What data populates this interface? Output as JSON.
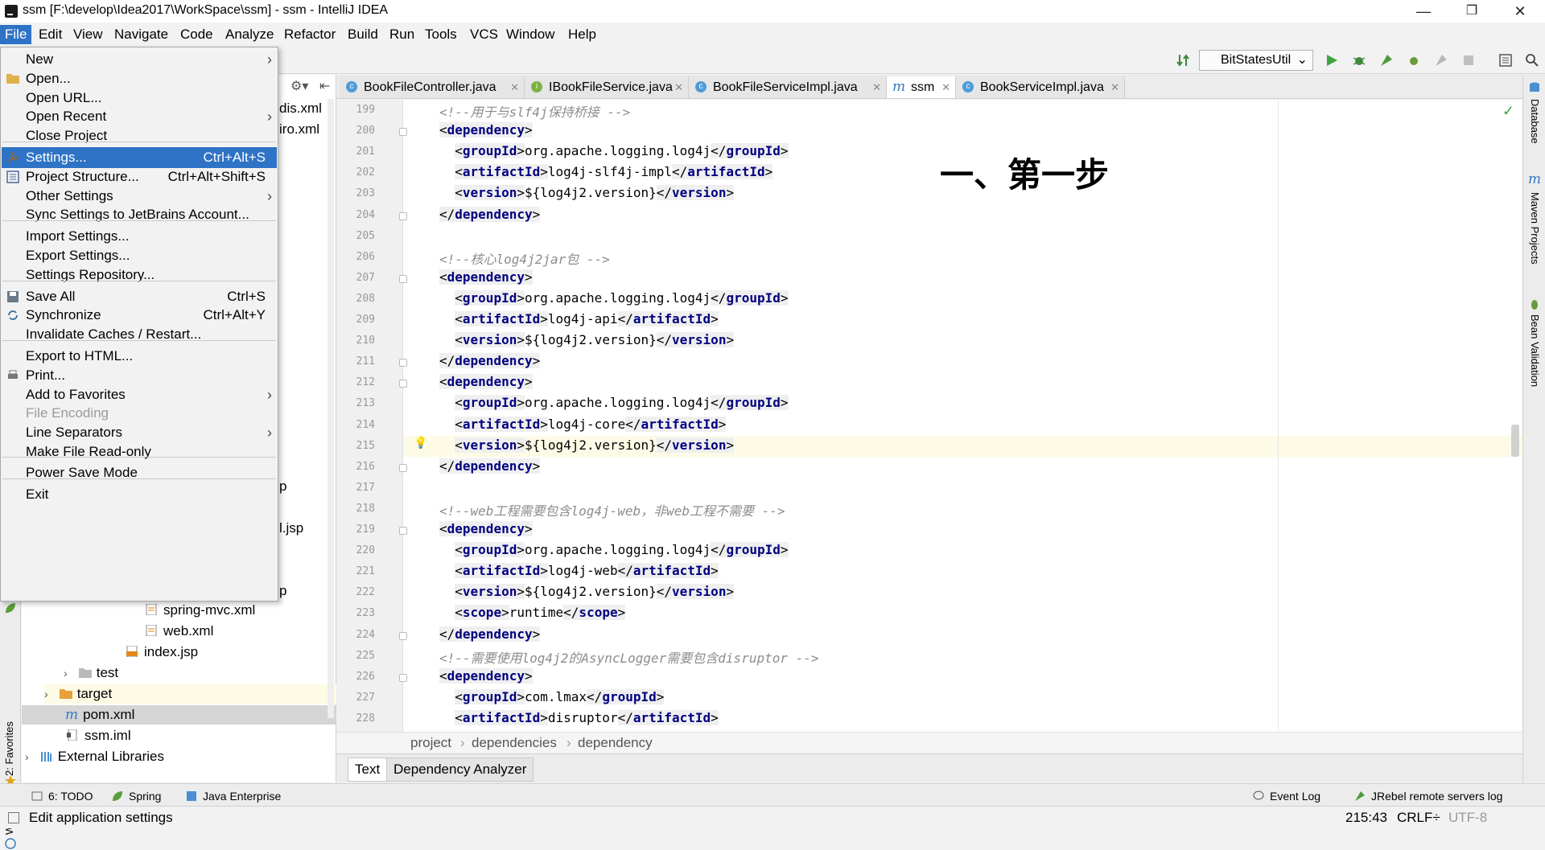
{
  "window": {
    "title": "ssm [F:\\develop\\Idea2017\\WorkSpace\\ssm] - ssm - IntelliJ IDEA",
    "minimize": "—",
    "maximize": "❐",
    "close": "✕"
  },
  "menubar": [
    "File",
    "Edit",
    "View",
    "Navigate",
    "Code",
    "Analyze",
    "Refactor",
    "Build",
    "Run",
    "Tools",
    "VCS",
    "Window",
    "Help"
  ],
  "toolbar": {
    "run_config": "BitStatesUtil"
  },
  "tabs": [
    {
      "label": "BookFileController.java",
      "icon": "class-icon"
    },
    {
      "label": "IBookFileService.java",
      "icon": "interface-icon"
    },
    {
      "label": "BookFileServiceImpl.java",
      "icon": "class-icon"
    },
    {
      "label": "ssm",
      "icon": "maven-icon"
    },
    {
      "label": "BookServiceImpl.java",
      "icon": "class-icon"
    }
  ],
  "file_menu": {
    "items": [
      {
        "label": "New",
        "submenu": true
      },
      {
        "label": "Open...",
        "icon": "folder-icon"
      },
      {
        "label": "Open URL..."
      },
      {
        "label": "Open Recent",
        "submenu": true
      },
      {
        "label": "Close Project"
      },
      {
        "label": "Settings...",
        "shortcut": "Ctrl+Alt+S",
        "icon": "wrench-icon"
      },
      {
        "label": "Project Structure...",
        "shortcut": "Ctrl+Alt+Shift+S",
        "icon": "project-structure-icon"
      },
      {
        "label": "Other Settings",
        "submenu": true
      },
      {
        "label": "Sync Settings to JetBrains Account..."
      },
      {
        "label": "Import Settings..."
      },
      {
        "label": "Export Settings..."
      },
      {
        "label": "Settings Repository..."
      },
      {
        "label": "Save All",
        "shortcut": "Ctrl+S",
        "icon": "save-icon"
      },
      {
        "label": "Synchronize",
        "shortcut": "Ctrl+Alt+Y",
        "icon": "sync-icon"
      },
      {
        "label": "Invalidate Caches / Restart..."
      },
      {
        "label": "Export to HTML..."
      },
      {
        "label": "Print...",
        "icon": "print-icon"
      },
      {
        "label": "Add to Favorites",
        "submenu": true
      },
      {
        "label": "File Encoding",
        "disabled": true
      },
      {
        "label": "Line Separators",
        "submenu": true
      },
      {
        "label": "Make File Read-only"
      },
      {
        "label": "Power Save Mode"
      },
      {
        "label": "Exit"
      }
    ]
  },
  "project_tree": {
    "partial_right": [
      "dis.xml",
      "iro.xml",
      "p",
      "l.jsp",
      "p"
    ],
    "rows": [
      {
        "label": "spring-mvc.xml",
        "icon": "xml-icon"
      },
      {
        "label": "web.xml",
        "icon": "xml-icon"
      },
      {
        "label": "index.jsp",
        "icon": "jsp-icon"
      },
      {
        "label": "test",
        "icon": "folder-icon"
      },
      {
        "label": "target",
        "icon": "folder-orange-icon"
      },
      {
        "label": "pom.xml",
        "icon": "maven-icon"
      },
      {
        "label": "ssm.iml",
        "icon": "iml-icon"
      },
      {
        "label": "External Libraries",
        "icon": "libraries-icon"
      }
    ]
  },
  "left_stripe": {
    "favorites": "2: Favorites",
    "web": "Web"
  },
  "right_stripe": {
    "database": "Database",
    "maven": "Maven Projects",
    "bean": "Bean Validation"
  },
  "editor": {
    "annotation": "一、第一步",
    "lines": [
      {
        "n": "199",
        "text": "<!--用于与slf4j保持桥接 -->"
      },
      {
        "n": "200",
        "text": "<dependency>"
      },
      {
        "n": "201",
        "text": "  <groupId>org.apache.logging.log4j</groupId>"
      },
      {
        "n": "202",
        "text": "  <artifactId>log4j-slf4j-impl</artifactId>"
      },
      {
        "n": "203",
        "text": "  <version>${log4j2.version}</version>"
      },
      {
        "n": "204",
        "text": "</dependency>"
      },
      {
        "n": "205",
        "text": ""
      },
      {
        "n": "206",
        "text": "<!--核心log4j2jar包 -->"
      },
      {
        "n": "207",
        "text": "<dependency>"
      },
      {
        "n": "208",
        "text": "  <groupId>org.apache.logging.log4j</groupId>"
      },
      {
        "n": "209",
        "text": "  <artifactId>log4j-api</artifactId>"
      },
      {
        "n": "210",
        "text": "  <version>${log4j2.version}</version>"
      },
      {
        "n": "211",
        "text": "</dependency>"
      },
      {
        "n": "212",
        "text": "<dependency>"
      },
      {
        "n": "213",
        "text": "  <groupId>org.apache.logging.log4j</groupId>"
      },
      {
        "n": "214",
        "text": "  <artifactId>log4j-core</artifactId>"
      },
      {
        "n": "215",
        "text": "  <version>${log4j2.version}</version>"
      },
      {
        "n": "216",
        "text": "</dependency>"
      },
      {
        "n": "217",
        "text": ""
      },
      {
        "n": "218",
        "text": "<!--web工程需要包含log4j-web，非web工程不需要 -->"
      },
      {
        "n": "219",
        "text": "<dependency>"
      },
      {
        "n": "220",
        "text": "  <groupId>org.apache.logging.log4j</groupId>"
      },
      {
        "n": "221",
        "text": "  <artifactId>log4j-web</artifactId>"
      },
      {
        "n": "222",
        "text": "  <version>${log4j2.version}</version>"
      },
      {
        "n": "223",
        "text": "  <scope>runtime</scope>"
      },
      {
        "n": "224",
        "text": "</dependency>"
      },
      {
        "n": "225",
        "text": "<!--需要使用log4j2的AsyncLogger需要包含disruptor -->"
      },
      {
        "n": "226",
        "text": "<dependency>"
      },
      {
        "n": "227",
        "text": "  <groupId>com.lmax</groupId>"
      },
      {
        "n": "228",
        "text": "  <artifactId>disruptor</artifactId>"
      }
    ]
  },
  "breadcrumb": [
    "project",
    "dependencies",
    "dependency"
  ],
  "bottom_tabs": [
    "Text",
    "Dependency Analyzer"
  ],
  "tool_windows": {
    "todo": "6: TODO",
    "spring": "Spring",
    "java_enterprise": "Java Enterprise",
    "event_log": "Event Log",
    "jrebel": "JRebel remote servers log"
  },
  "statusbar": {
    "message": "Edit application settings",
    "position": "215:43",
    "line_sep": "CRLF÷",
    "encoding": "UTF-8"
  },
  "colors": {
    "selection": "#2f73c6",
    "tag": "#000080",
    "comment": "#8c8c8c",
    "current_line": "#fdfbe6"
  }
}
